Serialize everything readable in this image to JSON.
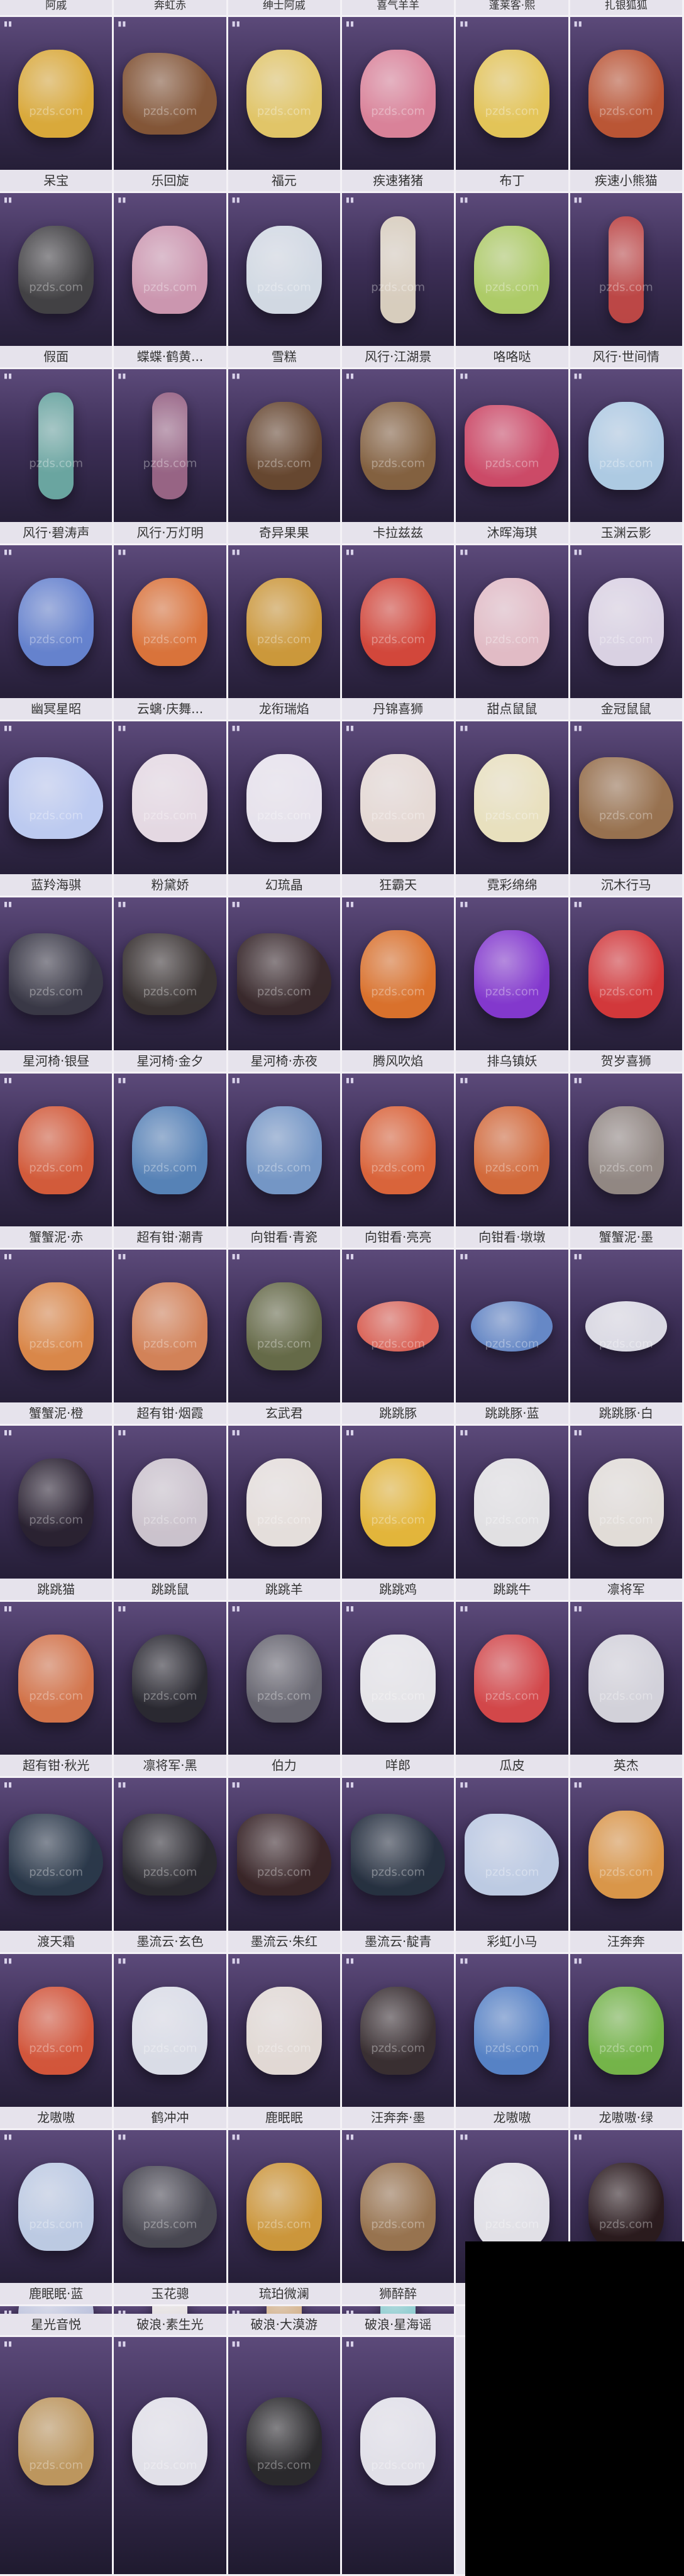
{
  "watermark": "pzds.com",
  "colors": {
    "card_dark": "#1f1a2f",
    "card_mid": "#5c4a7a",
    "label_bg": "#e6e3ec",
    "label_text": "#333333"
  },
  "top_row": [
    "阿戚",
    "奔虹赤",
    "绅士阿戚",
    "喜气羊羊",
    "蓬莱客·熙",
    "扎银狐狐"
  ],
  "items": [
    {
      "label": "呆宝",
      "art": "yellow-duck",
      "color": "#e8b53a"
    },
    {
      "label": "乐回旋",
      "art": "rocking-horse",
      "color": "#8a5a36"
    },
    {
      "label": "福元",
      "art": "duck-costume",
      "color": "#f0d36b"
    },
    {
      "label": "疾速猪猪",
      "art": "pink-pig",
      "color": "#e88aa0"
    },
    {
      "label": "布丁",
      "art": "yellow-chick",
      "color": "#f2d25a"
    },
    {
      "label": "疾速小熊猫",
      "art": "red-panda",
      "color": "#c65a34"
    },
    {
      "label": "假面",
      "art": "masked-duck",
      "color": "#444444"
    },
    {
      "label": "蝶蝶·鹤黄...",
      "art": "pink-butterfly",
      "color": "#d9a0b8"
    },
    {
      "label": "雪糕",
      "art": "snow-duck",
      "color": "#dfe8f0"
    },
    {
      "label": "风行·江湖景",
      "art": "skateboard",
      "color": "#e6dcc8"
    },
    {
      "label": "咯咯哒",
      "art": "green-bird",
      "color": "#b8d96a"
    },
    {
      "label": "风行·世间情",
      "art": "skateboard",
      "color": "#c84a46"
    },
    {
      "label": "风行·碧涛声",
      "art": "skateboard",
      "color": "#6fb0a8"
    },
    {
      "label": "风行·万灯明",
      "art": "skateboard",
      "color": "#a06a8a"
    },
    {
      "label": "奇异果果",
      "art": "capybara",
      "color": "#6b4a2e"
    },
    {
      "label": "卡拉兹兹",
      "art": "capybara",
      "color": "#8a6640"
    },
    {
      "label": "沐晖海琪",
      "art": "dragon-seahorse",
      "color": "#d94d6a"
    },
    {
      "label": "玉渊云影",
      "art": "crystal-beast",
      "color": "#b8d8f0"
    },
    {
      "label": "幽冥星昭",
      "art": "crystal-beast",
      "color": "#6a8ad9"
    },
    {
      "label": "云螭·庆舞...",
      "art": "lion-dance",
      "color": "#e87a3a"
    },
    {
      "label": "龙衔瑞焰",
      "art": "golden-dragon",
      "color": "#d9a23a"
    },
    {
      "label": "丹锦喜狮",
      "art": "lion-cat",
      "color": "#e04a3a"
    },
    {
      "label": "甜点鼠鼠",
      "art": "hamster",
      "color": "#f0c8d0"
    },
    {
      "label": "金冠鼠鼠",
      "art": "hamster",
      "color": "#e8e0f0"
    },
    {
      "label": "蓝羚海骐",
      "art": "ice-seahorse",
      "color": "#c8d8ff"
    },
    {
      "label": "粉黛娇",
      "art": "alpaca",
      "color": "#f4e8f0"
    },
    {
      "label": "幻琉晶",
      "art": "alpaca",
      "color": "#f6f2fa"
    },
    {
      "label": "狂霸天",
      "art": "alpaca",
      "color": "#f4e8e0"
    },
    {
      "label": "霓彩绵绵",
      "art": "alpaca",
      "color": "#f8f0c8"
    },
    {
      "label": "沉木行马",
      "art": "wood-horse",
      "color": "#a07850"
    },
    {
      "label": "星河椅·银昼",
      "art": "black-horse",
      "color": "#3a3a46"
    },
    {
      "label": "星河椅·金夕",
      "art": "black-horse",
      "color": "#3a3430"
    },
    {
      "label": "星河椅·赤夜",
      "art": "black-horse",
      "color": "#3a2a2a"
    },
    {
      "label": "腾风吹焰",
      "art": "fire",
      "color": "#e8782a"
    },
    {
      "label": "排乌镇妖",
      "art": "purple-spirit",
      "color": "#8a3ad9"
    },
    {
      "label": "贺岁喜狮",
      "art": "lion-dance",
      "color": "#e03a3a"
    },
    {
      "label": "蟹蟹泥·赤",
      "art": "crab",
      "color": "#e0603a"
    },
    {
      "label": "超有钳·潮青",
      "art": "crab",
      "color": "#5a8ac0"
    },
    {
      "label": "向钳看·青瓷",
      "art": "crab",
      "color": "#7aa0d0"
    },
    {
      "label": "向钳看·亮亮",
      "art": "crab",
      "color": "#e86a3a"
    },
    {
      "label": "向钳看·墩墩",
      "art": "crab",
      "color": "#e0703a"
    },
    {
      "label": "蟹蟹泥·墨",
      "art": "crab",
      "color": "#9a9088"
    },
    {
      "label": "蟹蟹泥·橙",
      "art": "crab",
      "color": "#e8904a"
    },
    {
      "label": "超有钳·烟霞",
      "art": "crab",
      "color": "#e08a5a"
    },
    {
      "label": "玄武君",
      "art": "turtle",
      "color": "#6a7048"
    },
    {
      "label": "跳跳豚",
      "art": "fish",
      "color": "#e86a5a"
    },
    {
      "label": "跳跳豚·蓝",
      "art": "fish",
      "color": "#6a90d0"
    },
    {
      "label": "跳跳豚·白",
      "art": "fish",
      "color": "#e8e8f0"
    },
    {
      "label": "跳跳猫",
      "art": "black-cat",
      "color": "#2a2230"
    },
    {
      "label": "跳跳鼠",
      "art": "grey-mouse",
      "color": "#d8d0d8"
    },
    {
      "label": "跳跳羊",
      "art": "sheep",
      "color": "#f4eee8"
    },
    {
      "label": "跳跳鸡",
      "art": "yellow-chick",
      "color": "#f2c23a"
    },
    {
      "label": "跳跳牛",
      "art": "cow",
      "color": "#f0f0f0"
    },
    {
      "label": "凛将军",
      "art": "goose",
      "color": "#f0ece4"
    },
    {
      "label": "超有钳·秋光",
      "art": "crab",
      "color": "#e07a4a"
    },
    {
      "label": "凛将军·黑",
      "art": "black-goose",
      "color": "#2a2a30"
    },
    {
      "label": "伯力",
      "art": "husky",
      "color": "#6a6a72"
    },
    {
      "label": "咩郎",
      "art": "white-dog",
      "color": "#f4f4f6"
    },
    {
      "label": "瓜皮",
      "art": "watermelon",
      "color": "#e04a4a"
    },
    {
      "label": "英杰",
      "art": "husky",
      "color": "#e0e0e6"
    },
    {
      "label": "渡天霜",
      "art": "black-horse",
      "color": "#2a3a4a"
    },
    {
      "label": "墨流云·玄色",
      "art": "black-horse",
      "color": "#2a2a2e"
    },
    {
      "label": "墨流云·朱红",
      "art": "black-horse",
      "color": "#3a2626"
    },
    {
      "label": "墨流云·靛青",
      "art": "black-horse",
      "color": "#263240"
    },
    {
      "label": "彩虹小马",
      "art": "toy-horse",
      "color": "#c8d8f0"
    },
    {
      "label": "汪奔奔",
      "art": "corgi",
      "color": "#e8a04a"
    },
    {
      "label": "龙嗷嗷",
      "art": "dino",
      "color": "#e05a3a"
    },
    {
      "label": "鹤冲冲",
      "art": "crane",
      "color": "#e8ecf4"
    },
    {
      "label": "鹿眠眠",
      "art": "deer",
      "color": "#f0e8e0"
    },
    {
      "label": "汪奔奔·墨",
      "art": "corgi",
      "color": "#3a3030"
    },
    {
      "label": "龙嗷嗷",
      "art": "dino",
      "color": "#5a8ad0"
    },
    {
      "label": "龙嗷嗷·绿",
      "art": "dino",
      "color": "#7ac04a"
    },
    {
      "label": "鹿眠眠·蓝",
      "art": "deer",
      "color": "#c8d8f0"
    },
    {
      "label": "玉花骢",
      "art": "black-horse",
      "color": "#4a4a52"
    },
    {
      "label": "琉珀微澜",
      "art": "goldfish",
      "color": "#d9a03a"
    },
    {
      "label": "狮醉醉",
      "art": "straw-hat-dog",
      "color": "#a07a50"
    },
    {
      "label": "",
      "art": "white-bear",
      "color": "#f0f0f4"
    },
    {
      "label": "",
      "art": "dark-beast",
      "color": "#2a1a1a"
    },
    {
      "label": "星光音悦",
      "art": "white-beast",
      "color": "#c8d0e8"
    },
    {
      "label": "破浪·素生光",
      "art": "surfboard",
      "color": "#f0ece8"
    },
    {
      "label": "破浪·大漠游",
      "art": "surfboard",
      "color": "#d9b07a"
    },
    {
      "label": "破浪·星海谣",
      "art": "surfboard",
      "color": "#7ad0d0"
    },
    {
      "label": "",
      "art": "empty",
      "color": "#e9e6ee"
    },
    {
      "label": "",
      "art": "empty",
      "color": "#e9e6ee"
    },
    {
      "label": "",
      "art": "cart",
      "color": "#c8a060"
    },
    {
      "label": "",
      "art": "white-fox",
      "color": "#f0f0f6"
    },
    {
      "label": "",
      "art": "dark-beast",
      "color": "#2a2a2a"
    },
    {
      "label": "",
      "art": "white-fox",
      "color": "#f0f0f6"
    },
    {
      "label": "",
      "art": "empty",
      "color": "#e9e6ee"
    },
    {
      "label": "",
      "art": "empty",
      "color": "#e9e6ee"
    }
  ]
}
